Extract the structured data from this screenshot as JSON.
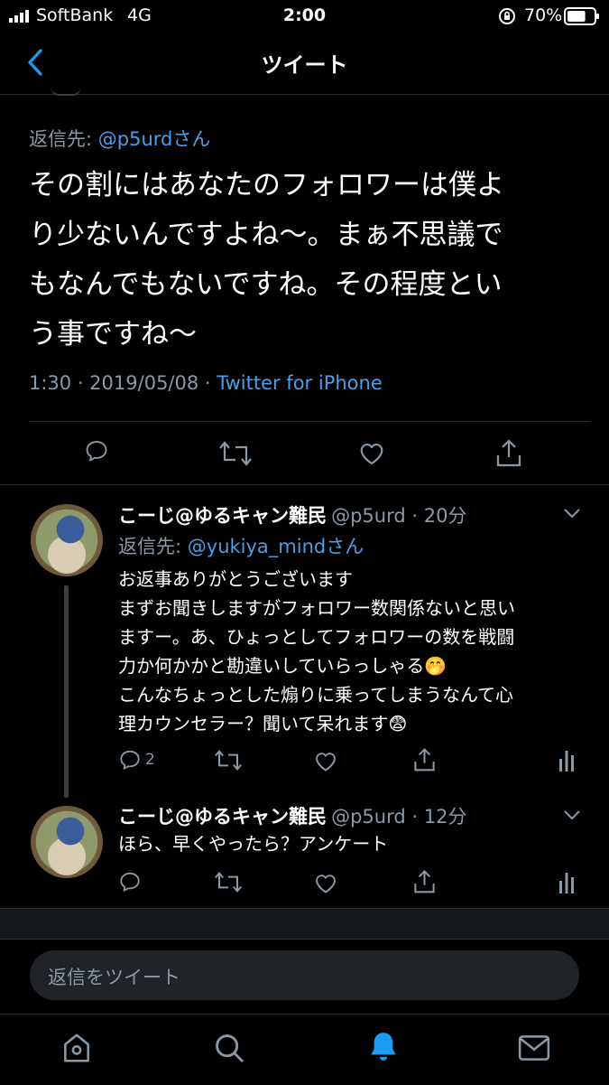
{
  "status_bar": {
    "carrier": "SoftBank",
    "network": "4G",
    "time": "2:00",
    "battery": "70%",
    "battery_level": 0.7
  },
  "nav": {
    "title": "ツイート"
  },
  "main_tweet": {
    "reply_prefix": "返信先: ",
    "reply_to": "@p5urdさん",
    "lines": [
      "その割にはあなたのフォロワーは僕よ",
      "り少ないんですよね〜。まぁ不思議で",
      "もなんでもないですね。その程度とい",
      "う事ですね〜"
    ],
    "meta_time": "1:30 · 2019/05/08 · ",
    "meta_source": "Twitter for iPhone"
  },
  "reply1": {
    "display_name": "こーじ@ゆるキャン難民",
    "handle_time": "@p5urd · 20分",
    "reply_prefix": "返信先: ",
    "reply_to": "@yukiya_mindさん",
    "lines": [
      "お返事ありがとうございます",
      "まずお聞きしますがフォロワー数関係ないと思い",
      "ますー。あ、ひょっとしてフォロワーの数を戦闘",
      "力か何かかと勘違いしていらっしゃる🤭",
      "こんなちょっとした煽りに乗ってしまうなんて心",
      "理カウンセラー？聞いて呆れます😨"
    ],
    "reply_count": "2"
  },
  "reply2": {
    "display_name": "こーじ@ゆるキャン難民",
    "handle_time": "@p5urd · 12分",
    "text": "ほら、早くやったら？アンケート"
  },
  "composer": {
    "placeholder": "返信をツイート"
  },
  "tabbar": {
    "icons": [
      "home-icon",
      "search-icon",
      "notifications-icon",
      "messages-icon"
    ],
    "active_color": "#1d9bf0"
  },
  "colors": {
    "link": "#4a9fe8",
    "muted": "#8b98a5",
    "background": "#000000"
  }
}
